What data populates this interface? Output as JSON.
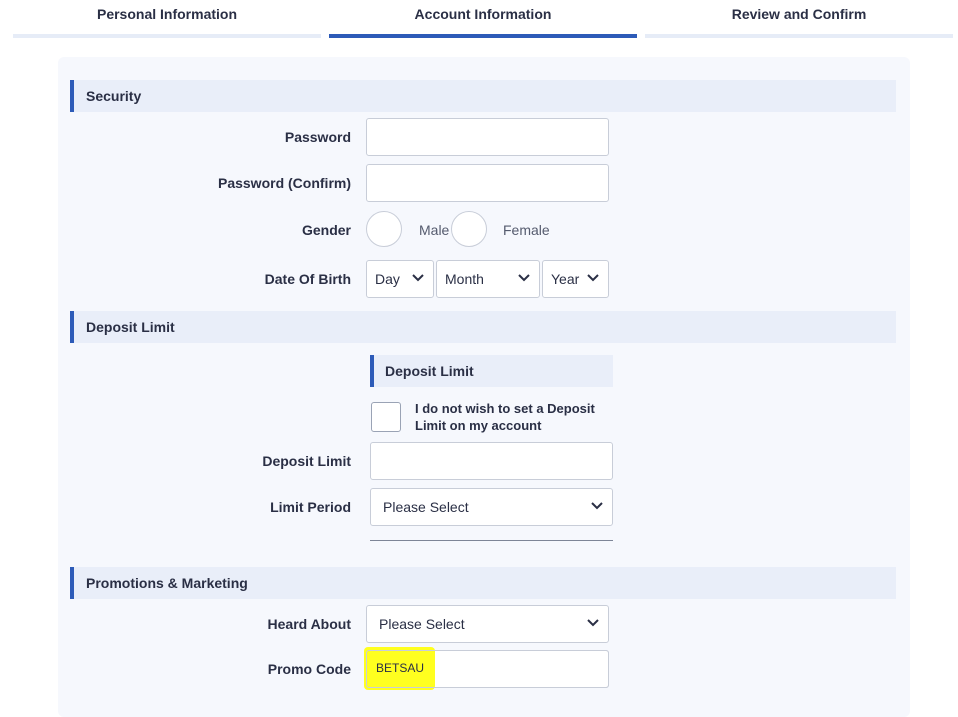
{
  "tabs": [
    {
      "label": "Personal Information",
      "active": false
    },
    {
      "label": "Account Information",
      "active": true
    },
    {
      "label": "Review and Confirm",
      "active": false
    }
  ],
  "security": {
    "header": "Security",
    "password_label": "Password",
    "password_value": "",
    "password_confirm_label": "Password (Confirm)",
    "password_confirm_value": "",
    "gender_label": "Gender",
    "gender_male": "Male",
    "gender_female": "Female",
    "dob_label": "Date Of Birth",
    "dob_day": "Day",
    "dob_month": "Month",
    "dob_year": "Year"
  },
  "deposit": {
    "header": "Deposit Limit",
    "subheader": "Deposit Limit",
    "no_limit_text": "I do not wish to set a Deposit Limit on my account",
    "no_limit_checked": false,
    "limit_label": "Deposit Limit",
    "limit_value": "",
    "period_label": "Limit Period",
    "period_value": "Please Select"
  },
  "promotions": {
    "header": "Promotions & Marketing",
    "heard_about_label": "Heard About",
    "heard_about_value": "Please Select",
    "promo_label": "Promo Code",
    "promo_value": "BETSAU"
  },
  "colors": {
    "accent": "#2d5bb8",
    "highlight": "#ffff1f",
    "panel_bg": "#f6f8fd",
    "header_bg": "#e9eef9"
  },
  "icons": {
    "dropdown": "chevron-down-icon"
  }
}
